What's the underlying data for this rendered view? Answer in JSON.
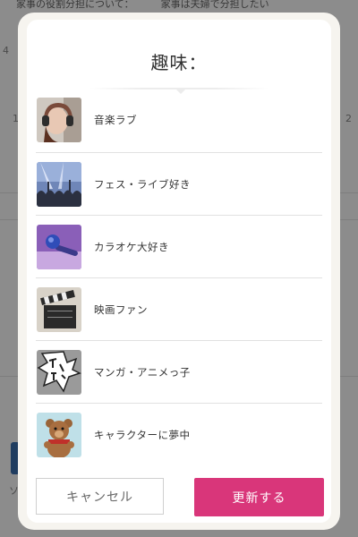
{
  "background": {
    "top_left_text": "家事の役割分担について：",
    "top_right_text": "家事は夫婦で分担したい",
    "side_mark_1": "4",
    "side_mark_2": "1",
    "side_mark_3": "2",
    "side_mark_4": "ソ"
  },
  "modal": {
    "title": "趣味：",
    "items": [
      {
        "label": "音楽ラブ",
        "icon": "music-headphones-photo"
      },
      {
        "label": "フェス・ライブ好き",
        "icon": "concert-crowd-photo"
      },
      {
        "label": "カラオケ大好き",
        "icon": "microphone-photo"
      },
      {
        "label": "映画ファン",
        "icon": "clapperboard-photo"
      },
      {
        "label": "マンガ・アニメっ子",
        "icon": "manga-speech-bubble-photo"
      },
      {
        "label": "キャラクターに夢中",
        "icon": "teddy-bear-photo"
      }
    ],
    "cancel_label": "キャンセル",
    "update_label": "更新する"
  },
  "colors": {
    "accent": "#d9367a",
    "overlay": "rgba(0,0,0,0.45)",
    "modal_frame": "#f6f4ef"
  }
}
